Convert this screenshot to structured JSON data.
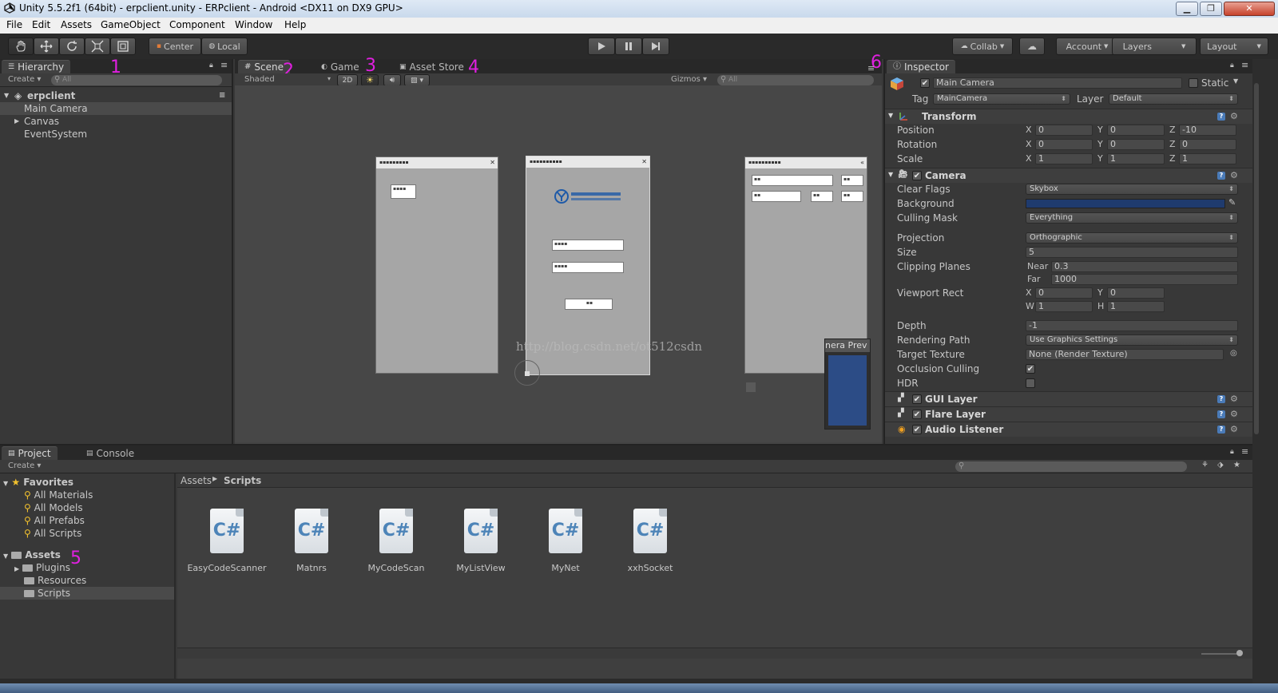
{
  "window": {
    "title": "Unity 5.5.2f1 (64bit) - erpclient.unity - ERPclient - Android <DX11 on DX9 GPU>"
  },
  "menu": [
    "File",
    "Edit",
    "Assets",
    "GameObject",
    "Component",
    "Window",
    "Help"
  ],
  "toolbar": {
    "pivot": "Center",
    "space": "Local",
    "collab": "Collab",
    "account": "Account",
    "layers": "Layers",
    "layout": "Layout"
  },
  "annotations": [
    "1",
    "2",
    "3",
    "4",
    "5",
    "6"
  ],
  "hierarchy": {
    "tab": "Hierarchy",
    "create": "Create",
    "search_placeholder": "All",
    "scene": "erpclient",
    "items": [
      "Main Camera",
      "Canvas",
      "EventSystem"
    ]
  },
  "scene": {
    "tabs": [
      "Scene",
      "Game",
      "Asset Store"
    ],
    "shading": "Shaded",
    "mode_2d": "2D",
    "gizmos": "Gizmos",
    "search_placeholder": "All",
    "watermark": "http://blog.csdn.net/ot512csdn",
    "preview_title": "nera Prev"
  },
  "inspector": {
    "tab": "Inspector",
    "object_name": "Main Camera",
    "static_label": "Static",
    "tag_label": "Tag",
    "tag_value": "MainCamera",
    "layer_label": "Layer",
    "layer_value": "Default",
    "transform": {
      "title": "Transform",
      "position": {
        "label": "Position",
        "x": "0",
        "y": "0",
        "z": "-10"
      },
      "rotation": {
        "label": "Rotation",
        "x": "0",
        "y": "0",
        "z": "0"
      },
      "scale": {
        "label": "Scale",
        "x": "1",
        "y": "1",
        "z": "1"
      }
    },
    "camera": {
      "title": "Camera",
      "clear_flags": {
        "label": "Clear Flags",
        "value": "Skybox"
      },
      "background": {
        "label": "Background",
        "color": "#1f3b6e"
      },
      "culling_mask": {
        "label": "Culling Mask",
        "value": "Everything"
      },
      "projection": {
        "label": "Projection",
        "value": "Orthographic"
      },
      "size": {
        "label": "Size",
        "value": "5"
      },
      "clipping": {
        "label": "Clipping Planes",
        "near_label": "Near",
        "near": "0.3",
        "far_label": "Far",
        "far": "1000"
      },
      "viewport": {
        "label": "Viewport Rect",
        "x": "0",
        "y": "0",
        "w": "1",
        "h": "1"
      },
      "depth": {
        "label": "Depth",
        "value": "-1"
      },
      "rendering_path": {
        "label": "Rendering Path",
        "value": "Use Graphics Settings"
      },
      "target_texture": {
        "label": "Target Texture",
        "value": "None (Render Texture)"
      },
      "occlusion": {
        "label": "Occlusion Culling"
      },
      "hdr": {
        "label": "HDR"
      }
    },
    "components": [
      "GUI Layer",
      "Flare Layer",
      "Audio Listener"
    ]
  },
  "project": {
    "tabs": [
      "Project",
      "Console"
    ],
    "create": "Create",
    "favorites_label": "Favorites",
    "favorites": [
      "All Materials",
      "All Models",
      "All Prefabs",
      "All Scripts"
    ],
    "assets_label": "Assets",
    "folders": [
      "Plugins",
      "Resources",
      "Scripts"
    ],
    "breadcrumb": [
      "Assets",
      "Scripts"
    ],
    "files": [
      "EasyCodeScanner",
      "Matnrs",
      "MyCodeScan",
      "MyListView",
      "MyNet",
      "xxhSocket"
    ],
    "cs_glyph": "C#"
  },
  "colors": {
    "accent": "#4a7bb8",
    "annotation": "#e020e0"
  }
}
